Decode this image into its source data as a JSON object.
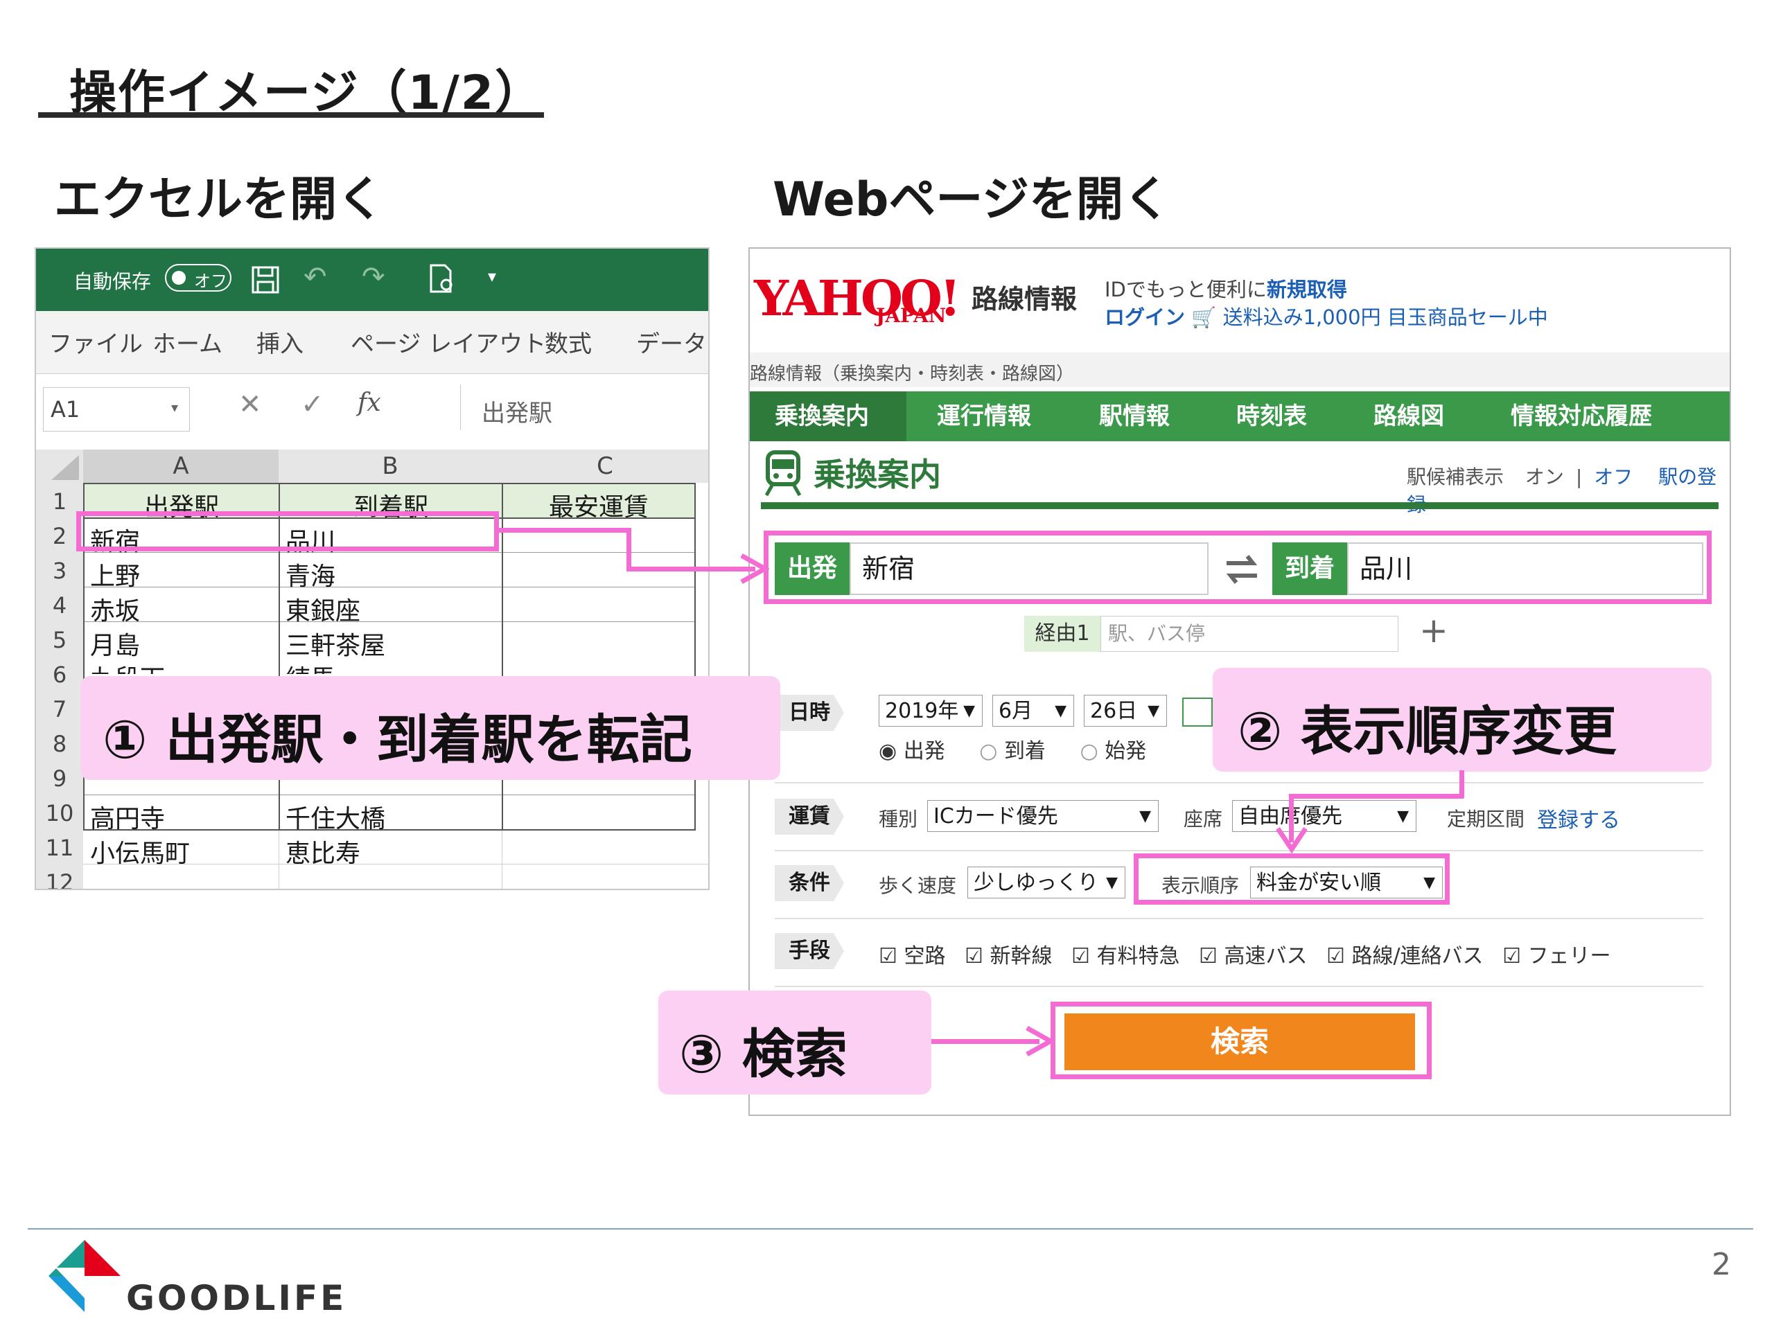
{
  "slide": {
    "title": "操作イメージ（1/2）",
    "left_heading": "エクセルを開く",
    "right_heading": "Webページを開く",
    "page_number": "2",
    "brand": "GOODLIFE"
  },
  "excel": {
    "autosave_label": "自動保存",
    "autosave_state": "オフ",
    "tabs": [
      "ファイル",
      "ホーム",
      "挿入",
      "ページ レイアウト",
      "数式",
      "データ"
    ],
    "name_box": "A1",
    "fx": "fx",
    "formula_value": "出発駅",
    "columns": [
      "A",
      "B",
      "C"
    ],
    "rows": [
      {
        "num": "1",
        "a": "出発駅",
        "b": "到着駅",
        "c": "最安運賃"
      },
      {
        "num": "2",
        "a": "新宿",
        "b": "品川",
        "c": ""
      },
      {
        "num": "3",
        "a": "上野",
        "b": "青海",
        "c": ""
      },
      {
        "num": "4",
        "a": "赤坂",
        "b": "東銀座",
        "c": ""
      },
      {
        "num": "5",
        "a": "月島",
        "b": "三軒茶屋",
        "c": ""
      },
      {
        "num": "6",
        "a": "九段下",
        "b": "練馬",
        "c": ""
      },
      {
        "num": "7",
        "a": "",
        "b": "",
        "c": ""
      },
      {
        "num": "8",
        "a": "",
        "b": "",
        "c": ""
      },
      {
        "num": "9",
        "a": "",
        "b": "",
        "c": ""
      },
      {
        "num": "10",
        "a": "高円寺",
        "b": "千住大橋",
        "c": ""
      },
      {
        "num": "11",
        "a": "小伝馬町",
        "b": "恵比寿",
        "c": ""
      },
      {
        "num": "12",
        "a": "",
        "b": "",
        "c": ""
      }
    ]
  },
  "yahoo": {
    "logo_text": "YAHOO!",
    "logo_sub": "JAPAN",
    "service_name": "路線情報",
    "promo1_prefix": "IDでもっと便利に",
    "promo1_link": "新規取得",
    "login": "ログイン",
    "promo2": "送料込み1,000円 目玉商品セール中",
    "breadcrumb": "路線情報（乗換案内・時刻表・路線図）",
    "nav": [
      "乗換案内",
      "運行情報",
      "駅情報",
      "時刻表",
      "路線図",
      "情報対応履歴"
    ],
    "section_title": "乗換案内",
    "station_suggest_label": "駅候補表示",
    "on": "オン",
    "divider": "|",
    "off": "オフ",
    "register_station": "駅の登録",
    "from_label": "出発",
    "from_value": "新宿",
    "to_label": "到着",
    "to_value": "品川",
    "via_label": "経由1",
    "via_placeholder": "駅、バス停",
    "datetime_label": "日時",
    "year": "2019年",
    "month": "6月",
    "day": "26日",
    "time_options": [
      "出発",
      "到着",
      "始発"
    ],
    "fare_label": "運賃",
    "type_label": "種別",
    "type_value": "ICカード優先",
    "seat_label": "座席",
    "seat_value": "自由席優先",
    "commuter_label": "定期区間",
    "commuter_link": "登録する",
    "cond_label": "条件",
    "walk_label": "歩く速度",
    "walk_value": "少しゆっくり",
    "order_label": "表示順序",
    "order_value": "料金が安い順",
    "means_label": "手段",
    "means": [
      "空路",
      "新幹線",
      "有料特急",
      "高速バス",
      "路線/連絡バス",
      "フェリー"
    ],
    "search_button": "検索"
  },
  "callouts": {
    "step1": "① 出発駅・到着駅を転記",
    "step2": "② 表示順序変更",
    "step3": "③ 検索"
  },
  "colors": {
    "excel_green": "#217346",
    "yahoo_green": "#3a9a4a",
    "highlight_pink": "#f46bd3",
    "callout_bg": "#fcd0f2",
    "search_orange": "#f0861c"
  }
}
